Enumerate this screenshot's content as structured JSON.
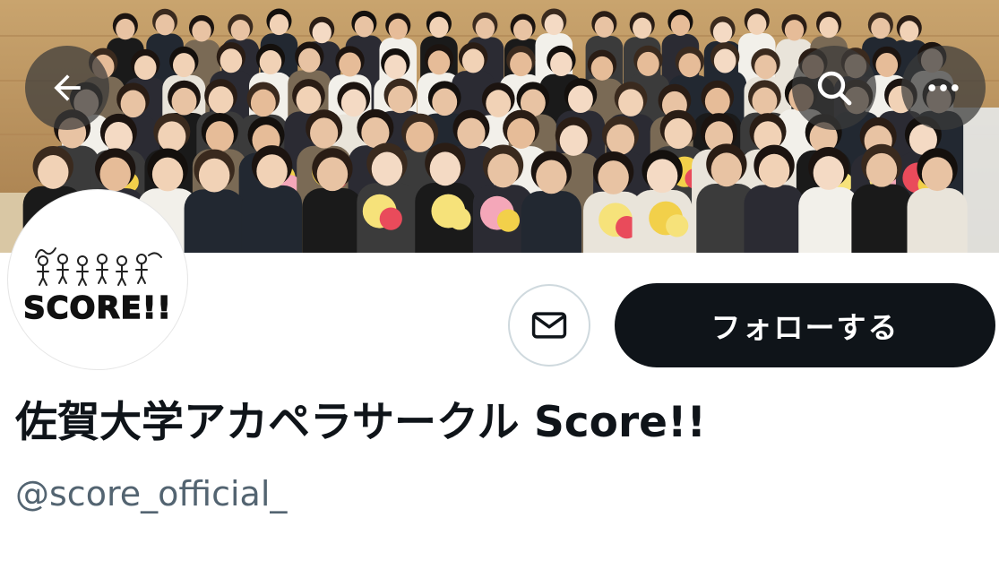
{
  "colors": {
    "follow_bg": "#0f1419",
    "follow_text": "#ffffff",
    "name_text": "#0f1419",
    "handle_text": "#536471",
    "overlay_button_bg": "#3a3a3a",
    "message_border": "#cfd9de"
  },
  "header": {
    "back_icon": "arrow-left-icon",
    "search_icon": "search-icon",
    "more_icon": "more-horizontal-icon"
  },
  "banner": {
    "image": "group-photo"
  },
  "avatar": {
    "logo_text": "SCORE!!"
  },
  "actions": {
    "message_icon": "envelope-icon",
    "follow_label": "フォローする"
  },
  "profile": {
    "display_name": "佐賀大学アカペラサークル Score!!",
    "handle": "@score_official_"
  }
}
